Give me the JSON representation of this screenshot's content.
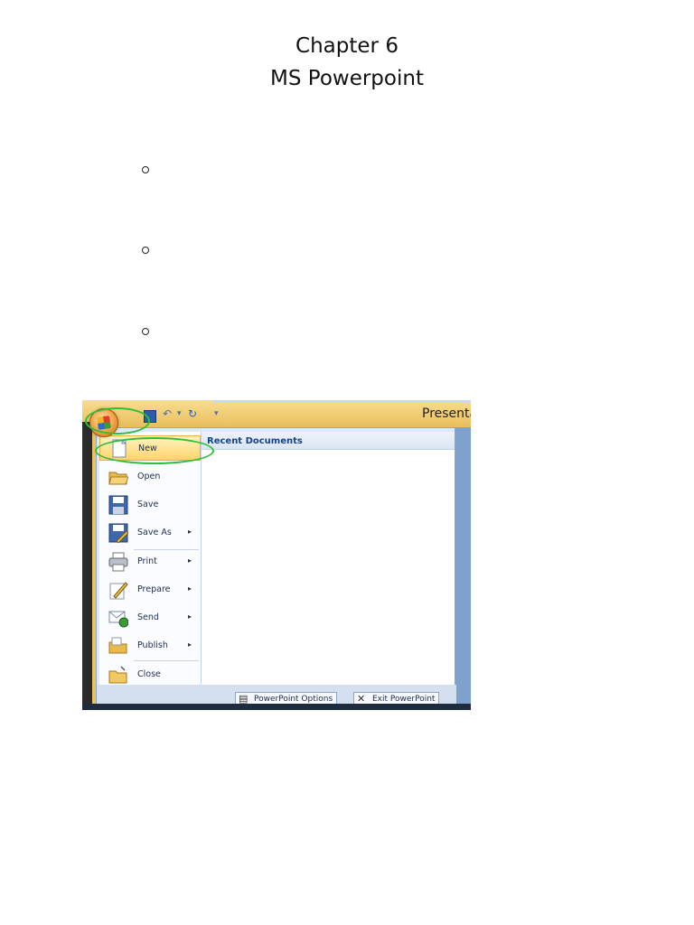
{
  "heading": {
    "line1": "Chapter 6",
    "line2": "MS Powerpoint"
  },
  "screenshot": {
    "title_fragment": "Presenta",
    "recent_header": "Recent Documents",
    "menu_items": [
      {
        "label": "New",
        "icon": "new-document-icon",
        "has_arrow": false
      },
      {
        "label": "Open",
        "icon": "open-folder-icon",
        "has_arrow": false
      },
      {
        "label": "Save",
        "icon": "save-disk-icon",
        "has_arrow": false
      },
      {
        "label": "Save As",
        "icon": "save-as-icon",
        "has_arrow": true
      },
      {
        "label": "Print",
        "icon": "printer-icon",
        "has_arrow": true
      },
      {
        "label": "Prepare",
        "icon": "prepare-pencil-icon",
        "has_arrow": true
      },
      {
        "label": "Send",
        "icon": "send-icon",
        "has_arrow": true
      },
      {
        "label": "Publish",
        "icon": "publish-folder-icon",
        "has_arrow": true
      },
      {
        "label": "Close",
        "icon": "close-folder-icon",
        "has_arrow": false
      }
    ],
    "options_button": "PowerPoint Options",
    "exit_button": "Exit PowerPoint",
    "highlight_color": "#2fbf3a"
  }
}
